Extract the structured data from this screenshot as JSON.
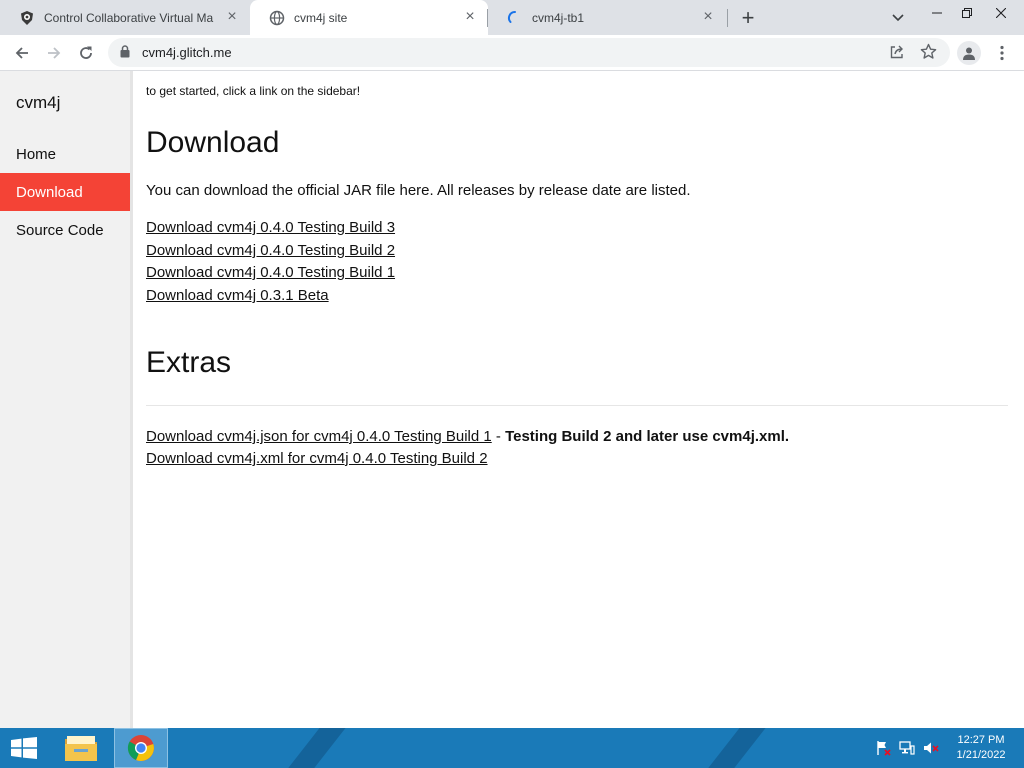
{
  "browser": {
    "tabs": [
      {
        "title": "Control Collaborative Virtual Ma",
        "icon": "cvm-logo-icon",
        "active": false
      },
      {
        "title": "cvm4j site",
        "icon": "globe-icon",
        "active": true
      },
      {
        "title": "cvm4j-tb1",
        "icon": "loading-spinner-icon",
        "active": false
      }
    ],
    "url": "cvm4j.glitch.me"
  },
  "sidebar": {
    "brand": "cvm4j",
    "items": [
      {
        "label": "Home",
        "active": false
      },
      {
        "label": "Download",
        "active": true
      },
      {
        "label": "Source Code",
        "active": false
      }
    ],
    "active_color": "#f44336"
  },
  "main": {
    "intro": "to get started, click a link on the sidebar!",
    "download_heading": "Download",
    "download_description": "You can download the official JAR file here. All releases by release date are listed.",
    "downloads": [
      "Download cvm4j 0.4.0 Testing Build 3",
      "Download cvm4j 0.4.0 Testing Build 2",
      "Download cvm4j 0.4.0 Testing Build 1",
      "Download cvm4j 0.3.1 Beta"
    ],
    "extras_heading": "Extras",
    "extras": [
      {
        "link": "Download cvm4j.json for cvm4j 0.4.0 Testing Build 1",
        "separator": " - ",
        "note": "Testing Build 2 and later use cvm4j.xml."
      },
      {
        "link": "Download cvm4j.xml for cvm4j 0.4.0 Testing Build 2",
        "separator": "",
        "note": ""
      }
    ]
  },
  "taskbar": {
    "time": "12:27 PM",
    "date": "1/21/2022",
    "color": "#1a7ab8"
  }
}
